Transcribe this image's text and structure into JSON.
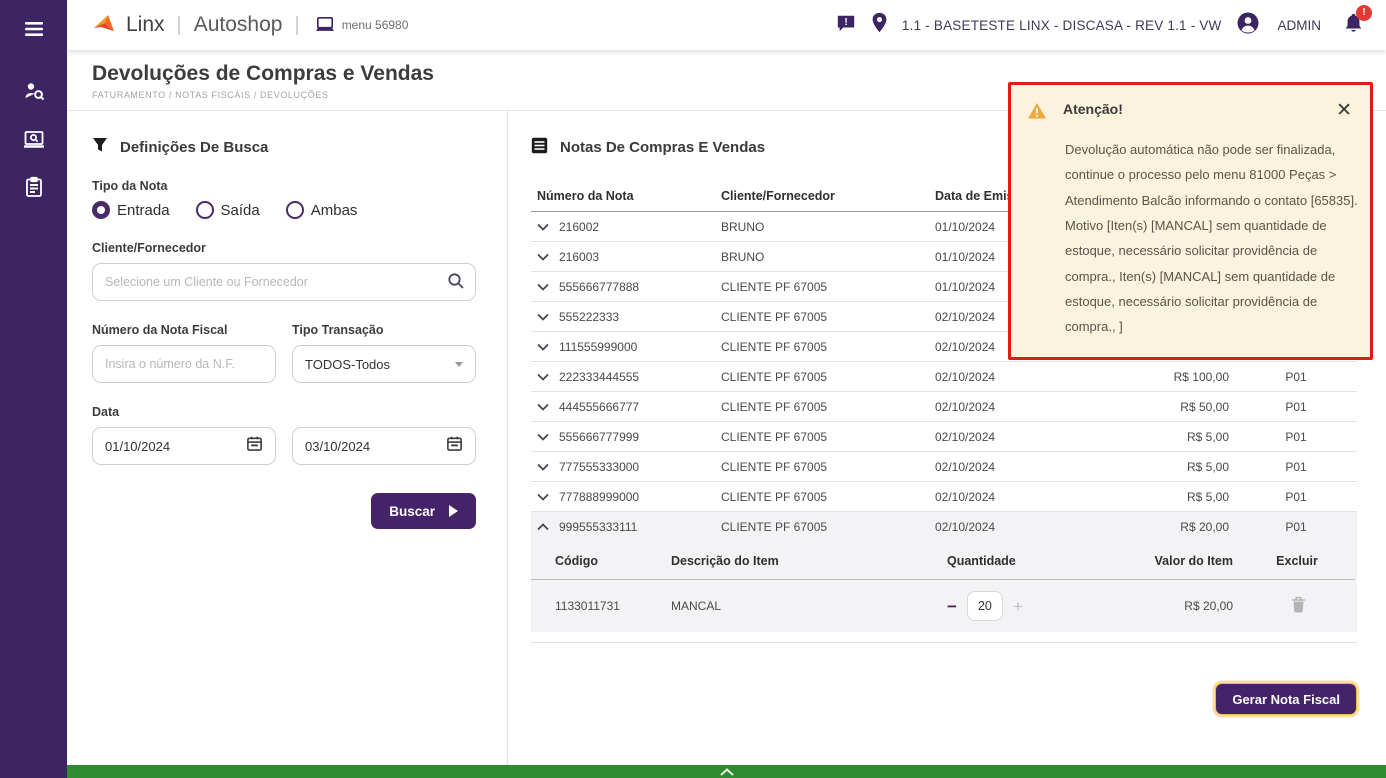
{
  "colors": {
    "sidebar_purple": "#3d2462",
    "accent_purple": "#44236a",
    "alert_bg": "#fbf3dd",
    "alert_border": "#e11b12",
    "footer_green": "#2e8b30",
    "badge_red": "#e23a33",
    "warning_orange": "#f2a93b"
  },
  "sidebar": {
    "icons": [
      "menu",
      "person-search",
      "screen-search",
      "clipboard"
    ]
  },
  "topbar": {
    "brand": "Linx",
    "product": "Autoshop",
    "menu_label": "menu 56980",
    "location": "1.1 - BASETESTE LINX - DISCASA - REV 1.1 - VW",
    "user": "ADMIN",
    "notification_badge": "!"
  },
  "page": {
    "title": "Devoluções de Compras e Vendas",
    "breadcrumb": "FATURAMENTO / NOTAS FISCAIS / DEVOLUÇÕES"
  },
  "filters": {
    "title": "Definições De Busca",
    "tipo_da_nota": {
      "label": "Tipo da Nota",
      "options": [
        {
          "label": "Entrada",
          "selected": true
        },
        {
          "label": "Saída",
          "selected": false
        },
        {
          "label": "Ambas",
          "selected": false
        }
      ]
    },
    "cliente": {
      "label": "Cliente/Fornecedor",
      "placeholder": "Selecione um Cliente ou Fornecedor"
    },
    "numero_nf": {
      "label": "Número da Nota Fiscal",
      "placeholder": "Insira o número da N.F."
    },
    "tipo_transacao": {
      "label": "Tipo Transação",
      "value": "TODOS-Todos"
    },
    "data": {
      "label": "Data",
      "start": "01/10/2024",
      "end": "03/10/2024"
    },
    "buscar_label": "Buscar"
  },
  "notas": {
    "title": "Notas De Compras E Vendas",
    "columns": {
      "num": "Número da Nota",
      "cliente": "Cliente/Fornecedor",
      "data": "Data de Emissão",
      "valor": "",
      "loja": ""
    },
    "rows": [
      {
        "num": "216002",
        "cliente": "BRUNO",
        "data": "01/10/2024",
        "valor": "",
        "loja": ""
      },
      {
        "num": "216003",
        "cliente": "BRUNO",
        "data": "01/10/2024",
        "valor": "",
        "loja": ""
      },
      {
        "num": "555666777888",
        "cliente": "CLIENTE PF 67005",
        "data": "01/10/2024",
        "valor": "",
        "loja": ""
      },
      {
        "num": "555222333",
        "cliente": "CLIENTE PF 67005",
        "data": "02/10/2024",
        "valor": "",
        "loja": ""
      },
      {
        "num": "111555999000",
        "cliente": "CLIENTE PF 67005",
        "data": "02/10/2024",
        "valor": "",
        "loja": ""
      },
      {
        "num": "222333444555",
        "cliente": "CLIENTE PF 67005",
        "data": "02/10/2024",
        "valor": "R$ 100,00",
        "loja": "P01"
      },
      {
        "num": "444555666777",
        "cliente": "CLIENTE PF 67005",
        "data": "02/10/2024",
        "valor": "R$ 50,00",
        "loja": "P01"
      },
      {
        "num": "555666777999",
        "cliente": "CLIENTE PF 67005",
        "data": "02/10/2024",
        "valor": "R$ 5,00",
        "loja": "P01"
      },
      {
        "num": "777555333000",
        "cliente": "CLIENTE PF 67005",
        "data": "02/10/2024",
        "valor": "R$ 5,00",
        "loja": "P01"
      },
      {
        "num": "777888999000",
        "cliente": "CLIENTE PF 67005",
        "data": "02/10/2024",
        "valor": "R$ 5,00",
        "loja": "P01"
      },
      {
        "num": "999555333111",
        "cliente": "CLIENTE PF 67005",
        "data": "02/10/2024",
        "valor": "R$ 20,00",
        "loja": "P01",
        "expanded": true
      }
    ],
    "detail": {
      "columns": {
        "codigo": "Código",
        "descricao": "Descrição do Item",
        "quantidade": "Quantidade",
        "valor": "Valor do Item",
        "excluir": "Excluir"
      },
      "items": [
        {
          "codigo": "1133011731",
          "descricao": "MANCAL",
          "quantidade": "20",
          "valor": "R$ 20,00"
        }
      ]
    },
    "gerar_label": "Gerar Nota Fiscal"
  },
  "alert": {
    "title": "Atenção!",
    "message": "Devolução automática não pode ser finalizada, continue o processo pelo menu 81000 Peças > Atendimento Balcão informando o contato [65835]. Motivo [Iten(s) [MANCAL] sem quantidade de estoque, necessário solicitar providência de compra., Iten(s) [MANCAL] sem quantidade de estoque, necessário solicitar providência de compra., ]"
  }
}
